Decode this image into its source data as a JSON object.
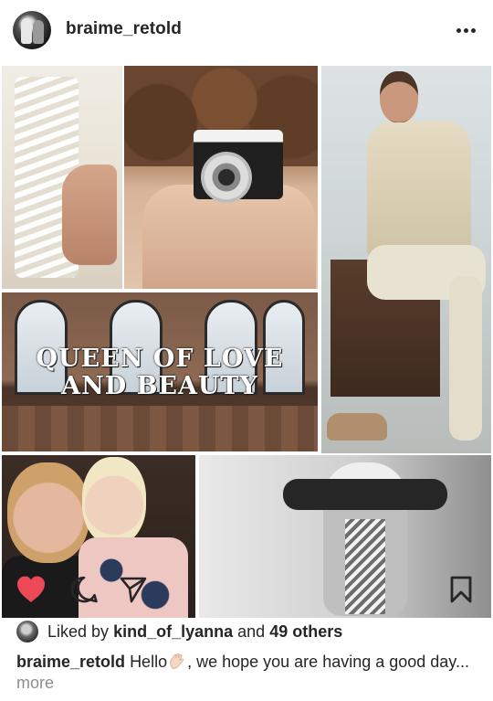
{
  "post": {
    "username": "braime_retold",
    "more_icon": "more-dots-icon",
    "collage_text": "QUEEN OF LOVE AND BEAUTY",
    "collage_text_line1": "QUEEN OF LOVE",
    "collage_text_line2": "AND BEAUTY"
  },
  "actions": {
    "like_icon": "heart-icon",
    "liked": true,
    "like_color": "#ED4956",
    "comment_icon": "comment-icon",
    "share_icon": "send-icon",
    "save_icon": "bookmark-icon"
  },
  "likes": {
    "prefix": "Liked by",
    "user": "kind_of_lyanna",
    "middle": "and",
    "others": "49 others"
  },
  "caption": {
    "username": "braime_retold",
    "text_before_emoji": "Hello",
    "emoji": "waving-hand",
    "text_after_emoji": ", we hope you are having a good day...",
    "more_label": "more"
  }
}
